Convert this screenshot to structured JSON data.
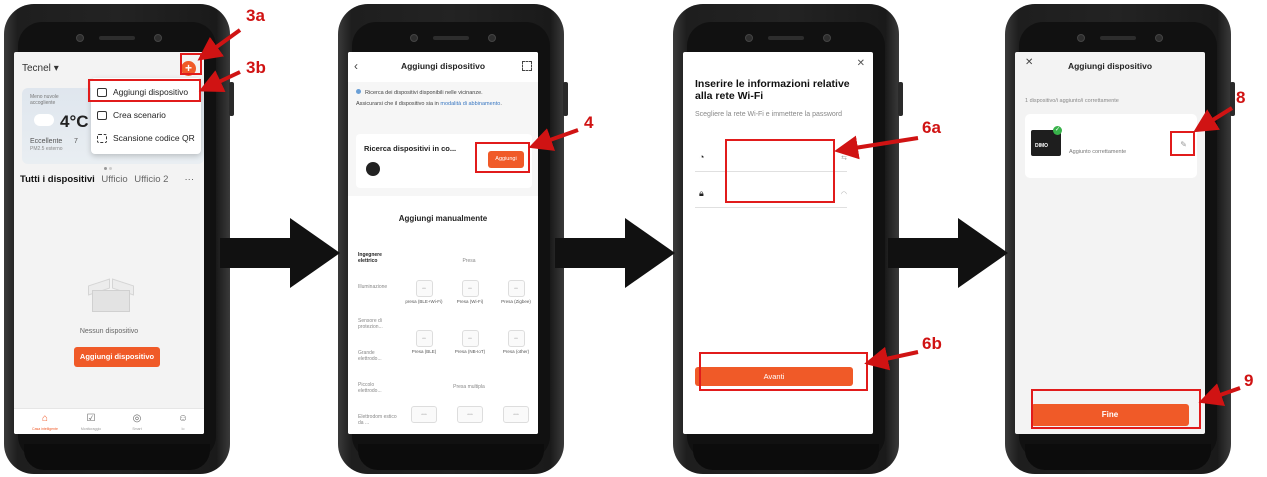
{
  "screen1": {
    "home_name": "Tecnel",
    "weather_small": "Meno nuvole accogliente",
    "temperature": "4°C",
    "air_quality": "Eccellente",
    "air_quality_sub": "PM2.5 esterno",
    "seven_prefix": "7",
    "menu": [
      "Aggiungi dispositivo",
      "Crea scenario",
      "Scansione codice QR"
    ],
    "tabs": [
      "Tutti i dispositivi",
      "Ufficio",
      "Ufficio 2"
    ],
    "more": "···",
    "empty_label": "Nessun dispositivo",
    "add_button": "Aggiungi dispositivo",
    "nav_labels": [
      "Casa intelligente",
      "Monitoraggio",
      "Smart",
      "Io"
    ]
  },
  "screen2": {
    "title": "Aggiungi dispositivo",
    "info_line1": "Ricerca dei dispositivi disponibili nelle vicinanze.",
    "info_line2": "Assicurarsi che il dispositivo sia in",
    "info_link": "modalità di abbinamento",
    "info_end": ".",
    "search_title": "Ricerca dispositivi in co...",
    "add_button": "Aggiungi",
    "manual_title": "Aggiungi manualmente",
    "categories": [
      "Ingegnere elettrico",
      "Illuminazione",
      "Sensore di protezion...",
      "Grande elettrodo...",
      "Piccolo elettrodo...",
      "Elettrodom estico da ..."
    ],
    "section_presa": "Presa",
    "section_multipla": "Presa multipla",
    "devices": [
      "presa (BLE+Wi-Fi)",
      "Presa (Wi-Fi)",
      "Presa (Zigbee)",
      "Presa (BLE)",
      "Presa (NB-IoT)",
      "Presa (other)"
    ]
  },
  "screen3": {
    "title": "Inserire le informazioni relative alla rete Wi-Fi",
    "subtitle": "Scegliere la rete Wi-Fi e immettere la password",
    "button": "Avanti"
  },
  "screen4": {
    "title": "Aggiungi dispositivo",
    "count": "1 dispositivo/i aggiunto/i correttamente",
    "thumb_logo": "DIMO",
    "status": "Aggiunto correttamente",
    "button": "Fine"
  },
  "annotations": [
    "3a",
    "3b",
    "4",
    "6a",
    "6b",
    "8",
    "9"
  ],
  "colors": {
    "accent": "#f05a28",
    "annotation": "#e11b1b"
  }
}
